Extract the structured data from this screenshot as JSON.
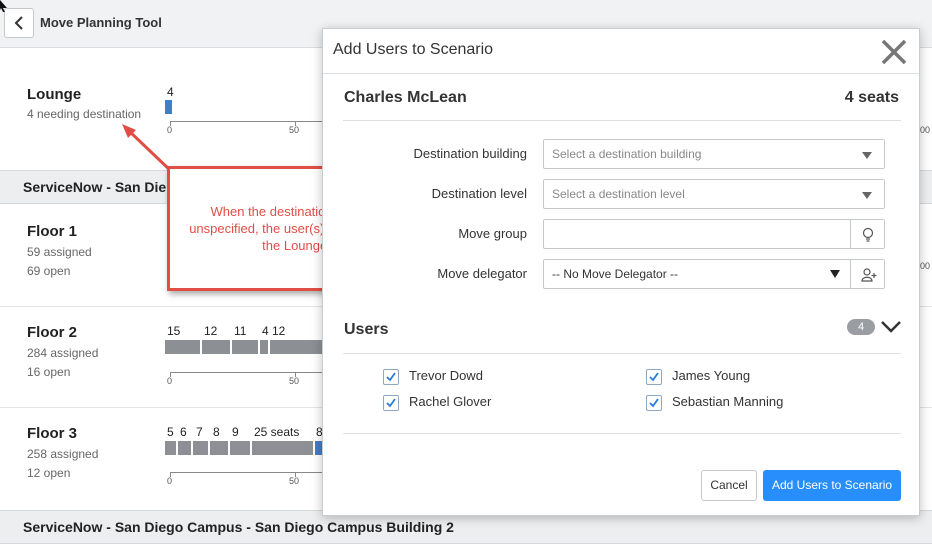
{
  "app": {
    "title": "Move Planning Tool"
  },
  "background": {
    "lounge": {
      "title": "Lounge",
      "subtitle": "4 needing destination",
      "bar_value_label": "4",
      "axis_ticks": [
        "0",
        "50"
      ]
    },
    "section1": {
      "title": "ServiceNow - San Die"
    },
    "floor1": {
      "title": "Floor 1",
      "assigned": "59 assigned",
      "open": "69 open"
    },
    "floor2": {
      "title": "Floor 2",
      "assigned": "284 assigned",
      "open": "16 open",
      "segment_labels": [
        "15",
        "12",
        "11",
        "4",
        "12"
      ],
      "axis_ticks": [
        "0",
        "50"
      ]
    },
    "floor3": {
      "title": "Floor 3",
      "assigned": "258 assigned",
      "open": "12 open",
      "segment_labels": [
        "5",
        "6",
        "7",
        "8",
        "9",
        "25 seats",
        "8"
      ],
      "axis_ticks": [
        "0",
        "50"
      ]
    },
    "section2": {
      "title": "ServiceNow - San Diego Campus - San Diego Campus Building 2"
    },
    "right_edge_label": "00"
  },
  "annotation": {
    "text": "When the destinations are left unspecified, the user(s) are moved to the Lounge.",
    "color": "#e04e46"
  },
  "modal": {
    "title": "Add Users to Scenario",
    "person_name": "Charles McLean",
    "seats": "4 seats",
    "fields": {
      "destination_building": {
        "label": "Destination building",
        "placeholder": "Select a destination building"
      },
      "destination_level": {
        "label": "Destination level",
        "placeholder": "Select a destination level"
      },
      "move_group": {
        "label": "Move group",
        "value": ""
      },
      "move_delegator": {
        "label": "Move delegator",
        "value": "-- No Move Delegator --"
      }
    },
    "users": {
      "heading": "Users",
      "count": "4",
      "list": [
        "Trevor Dowd",
        "James Young",
        "Rachel Glover",
        "Sebastian Manning"
      ]
    },
    "buttons": {
      "cancel": "Cancel",
      "add": "Add Users to Scenario"
    }
  },
  "colors": {
    "primary": "#278efc",
    "bar_gray": "#8c9094",
    "bar_blue": "#3d7fc9"
  }
}
